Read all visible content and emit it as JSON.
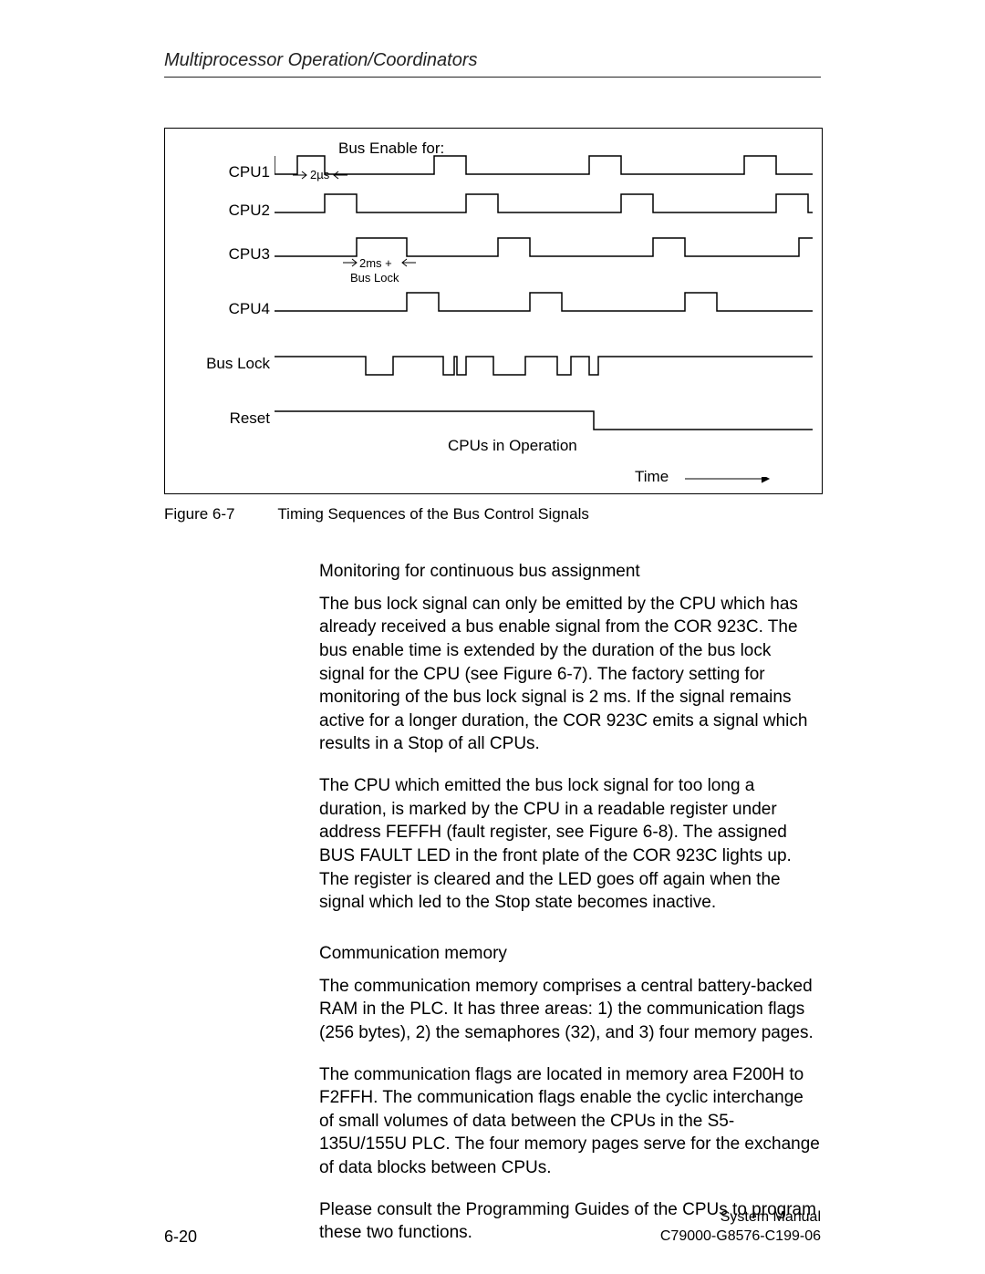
{
  "header": "Multiprocessor Operation/Coordinators",
  "figure": {
    "title": "Bus Enable for:",
    "labels": {
      "cpu1": "CPU1",
      "cpu2": "CPU2",
      "cpu3": "CPU3",
      "cpu4": "CPU4",
      "buslock": "Bus Lock",
      "reset": "Reset",
      "mu1": "2µs",
      "mu2": "2ms  +",
      "lock_note": "Bus Lock",
      "cpus_op": "CPUs in Operation",
      "time": "Time"
    }
  },
  "caption": {
    "num": "Figure 6-7",
    "text": "Timing Sequences of the Bus Control Signals"
  },
  "body": {
    "h1": "Monitoring for continuous bus assignment",
    "p1": "The bus lock signal can only be emitted by the CPU which has already received a bus enable signal from the COR 923C. The bus enable time is extended by the duration of the bus lock signal for the CPU (see Figure 6-7). The factory setting for monitoring of the bus lock signal is 2 ms. If the signal remains active for a longer duration, the COR 923C emits a signal which results in a Stop of all CPUs.",
    "p2": "The CPU which emitted the bus lock signal for too long a duration, is marked by the CPU in a readable register under address FEFFH (fault register, see Figure 6-8). The assigned BUS FAULT LED in the front plate of the COR 923C lights up. The register is cleared and the LED goes off again when the signal which led to the Stop state becomes inactive.",
    "h2": "Communication memory",
    "p3": "The communication memory comprises a central battery-backed RAM in the PLC. It has three areas: 1) the communication flags (256 bytes), 2) the semaphores (32), and 3) four memory pages.",
    "p4": "The communication flags are located in memory area F200H to F2FFH. The communication flags enable the cyclic interchange of small volumes of data between the CPUs in the S5-135U/155U PLC. The four memory pages serve for the exchange of data blocks between CPUs.",
    "p5": "Please consult the Programming Guides of the CPUs to program these two functions."
  },
  "footer": {
    "page": "6-20",
    "doc1": "System Manual",
    "doc2": "C79000-G8576-C199-06"
  },
  "chart_data": {
    "type": "timing-diagram",
    "signals": [
      {
        "name": "CPU1",
        "pulses": [
          [
            0,
            25
          ],
          [
            130,
            165
          ],
          [
            300,
            335
          ],
          [
            470,
            505
          ]
        ]
      },
      {
        "name": "CPU2",
        "pulses": [
          [
            25,
            60
          ],
          [
            165,
            200
          ],
          [
            335,
            370
          ],
          [
            505,
            540
          ]
        ]
      },
      {
        "name": "CPU3",
        "pulses": [
          [
            60,
            115
          ],
          [
            200,
            235
          ],
          [
            370,
            405
          ],
          [
            540,
            560
          ]
        ]
      },
      {
        "name": "CPU4",
        "pulses": [
          [
            115,
            130
          ],
          [
            235,
            270
          ],
          [
            405,
            440
          ]
        ]
      },
      {
        "name": "Bus Lock",
        "type": "low-active",
        "pulses": [
          [
            75,
            100
          ],
          [
            150,
            160
          ],
          [
            195,
            227
          ],
          [
            260,
            273
          ],
          [
            290,
            300
          ]
        ]
      },
      {
        "name": "Reset",
        "type": "low-active",
        "pulses": [
          [
            300,
            560
          ]
        ]
      }
    ],
    "x_range": [
      0,
      560
    ],
    "annotations": [
      "2µs bus enable slot",
      "2ms + Bus Lock extension",
      "CPUs in Operation region after reset end"
    ]
  }
}
